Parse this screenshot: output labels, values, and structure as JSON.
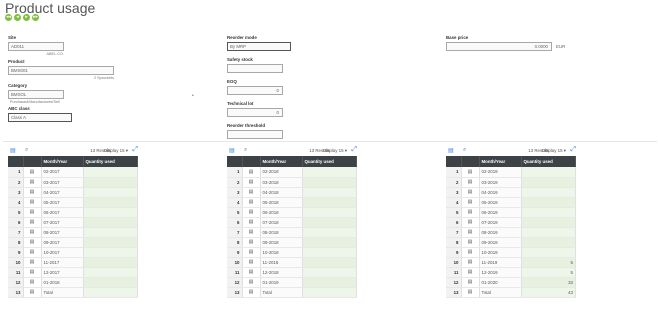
{
  "page": {
    "title": "Product usage",
    "nav": [
      "◂◂",
      "◂",
      "▸",
      "▸▸"
    ]
  },
  "form": {
    "site_label": "Site",
    "site_value": "AD011",
    "site_sub": "ABEL.CO.",
    "product_label": "Product",
    "product_value": "BMS001",
    "product_sub": "2 Sprockets",
    "category_label": "Category",
    "category_value": "BMSOL",
    "category_sub": "Purchased/Manufactured/Sell",
    "abc_label": "ABC class",
    "abc_value": "Class A",
    "reorder_mode_label": "Reorder mode",
    "reorder_mode_value": "By MRP",
    "safety_label": "Safety stock",
    "safety_value": "",
    "eoq_label": "EOQ",
    "eoq_value": "0",
    "technical_lot_label": "Technical lot",
    "technical_lot_value": "0",
    "reorder_threshold_label": "Reorder threshold",
    "reorder_threshold_value": "",
    "base_price_label": "Base price",
    "base_price_value": "0.0000",
    "base_price_unit": "EUR"
  },
  "panels": [
    {
      "results": "13 Results",
      "display": "Display",
      "display_val": "15",
      "col_month": "Month/Year",
      "col_qty": "Quantity used",
      "rows": [
        [
          "1",
          "02-2017",
          ""
        ],
        [
          "2",
          "03-2017",
          ""
        ],
        [
          "3",
          "04-2017",
          ""
        ],
        [
          "4",
          "05-2017",
          ""
        ],
        [
          "5",
          "06-2017",
          ""
        ],
        [
          "6",
          "07-2017",
          ""
        ],
        [
          "7",
          "08-2017",
          ""
        ],
        [
          "8",
          "09-2017",
          ""
        ],
        [
          "9",
          "10-2017",
          ""
        ],
        [
          "10",
          "11-2017",
          ""
        ],
        [
          "11",
          "12-2017",
          ""
        ],
        [
          "12",
          "01-2018",
          ""
        ],
        [
          "13",
          "Total",
          ""
        ]
      ]
    },
    {
      "results": "13 Results",
      "display": "Display",
      "display_val": "15",
      "col_month": "Month/Year",
      "col_qty": "Quantity used",
      "rows": [
        [
          "1",
          "02-2018",
          ""
        ],
        [
          "2",
          "03-2018",
          ""
        ],
        [
          "3",
          "04-2018",
          ""
        ],
        [
          "4",
          "05-2018",
          ""
        ],
        [
          "5",
          "06-2018",
          ""
        ],
        [
          "6",
          "07-2018",
          ""
        ],
        [
          "7",
          "08-2018",
          ""
        ],
        [
          "8",
          "09-2018",
          ""
        ],
        [
          "9",
          "10-2018",
          ""
        ],
        [
          "10",
          "11-2018",
          ""
        ],
        [
          "11",
          "12-2018",
          ""
        ],
        [
          "12",
          "01-2019",
          ""
        ],
        [
          "13",
          "Total",
          ""
        ]
      ]
    },
    {
      "results": "13 Results",
      "display": "Display",
      "display_val": "15",
      "col_month": "Month/Year",
      "col_qty": "Quantity used",
      "rows": [
        [
          "1",
          "02-2019",
          ""
        ],
        [
          "2",
          "03-2019",
          ""
        ],
        [
          "3",
          "04-2019",
          ""
        ],
        [
          "4",
          "05-2019",
          ""
        ],
        [
          "5",
          "06-2019",
          ""
        ],
        [
          "6",
          "07-2019",
          ""
        ],
        [
          "7",
          "08-2019",
          ""
        ],
        [
          "8",
          "09-2019",
          ""
        ],
        [
          "9",
          "10-2019",
          ""
        ],
        [
          "10",
          "11-2019",
          "5"
        ],
        [
          "11",
          "12-2019",
          "5"
        ],
        [
          "12",
          "01-2020",
          "33"
        ],
        [
          "13",
          "Total",
          "43"
        ]
      ]
    }
  ]
}
